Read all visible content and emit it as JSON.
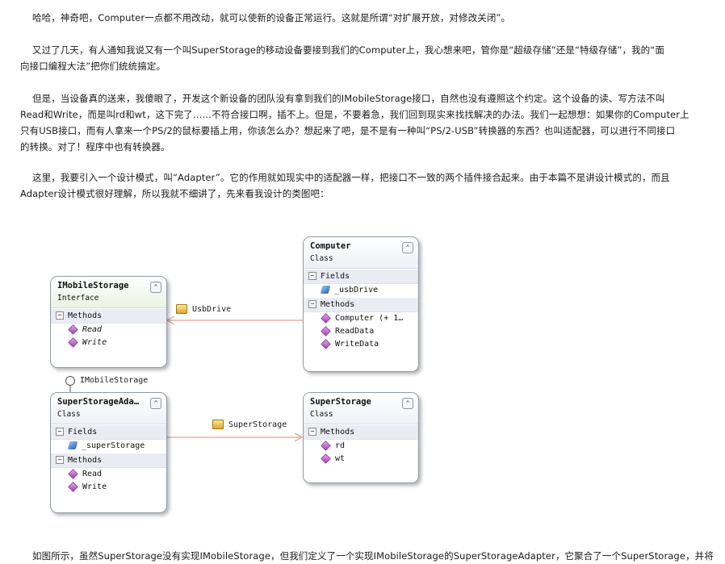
{
  "paragraphs": {
    "p1": "哈哈，神奇吧，Computer一点都不用改动，就可以使新的设备正常运行。这就是所谓“对扩展开放，对修改关闭”。",
    "p2_l1": "又过了几天，有人通知我说又有一个叫SuperStorage的移动设备要接到我们的Computer上，我心想来吧，管你是“超级存储”还是“特级存储”，我的“面",
    "p2_l2": "向接口编程大法”把你们统统搞定。",
    "p3_l1": "但是，当设备真的送来，我傻眼了，开发这个新设备的团队没有拿到我们的IMobileStorage接口，自然也没有遵照这个约定。这个设备的读、写方法不叫",
    "p3_l2": "Read和Write，而是叫rd和wt，这下完了……不符合接口啊，插不上。但是，不要着急，我们回到现实来找找解决的办法。我们一起想想：如果你的Computer上",
    "p3_l3": "只有USB接口，而有人拿来一个PS/2的鼠标要插上用，你该怎么办？想起来了吧，是不是有一种叫“PS/2-USB”转换器的东西？也叫适配器，可以进行不同接口",
    "p3_l4": "的转换。对了！程序中也有转换器。",
    "p4_l1": "这里，我要引入一个设计模式，叫“Adapter”。它的作用就如现实中的适配器一样，把接口不一致的两个插件接合起来。由于本篇不是讲设计模式的，而且",
    "p4_l2": "Adapter设计模式很好理解，所以我就不细讲了，先来看我设计的类图吧：",
    "p5_l1": "如图所示，虽然SuperStorage没有实现IMobileStorage，但我们定义了一个实现IMobileStorage的SuperStorageAdapter，它聚合了一个SuperStorage，并将"
  },
  "diagram": {
    "imobile": {
      "name": "IMobileStorage",
      "stereotype": "Interface",
      "methods_label": "Methods",
      "methods": [
        "Read",
        "Write"
      ]
    },
    "computer": {
      "name": "Computer",
      "stereotype": "Class",
      "fields_label": "Fields",
      "fields": [
        "_usbDrive"
      ],
      "methods_label": "Methods",
      "methods": [
        "Computer  (+ 1…",
        "ReadData",
        "WriteData"
      ]
    },
    "adapter": {
      "name": "SuperStorageAda…",
      "stereotype": "Class",
      "fields_label": "Fields",
      "fields": [
        "_superStorage"
      ],
      "methods_label": "Methods",
      "methods": [
        "Read",
        "Write"
      ]
    },
    "superstorage": {
      "name": "SuperStorage",
      "stereotype": "Class",
      "methods_label": "Methods",
      "methods": [
        "rd",
        "wt"
      ]
    },
    "assoc_usb": "UsbDrive",
    "assoc_super": "SuperStorage",
    "lollipop": "IMobileStorage",
    "collapse_glyph": "⌃"
  }
}
